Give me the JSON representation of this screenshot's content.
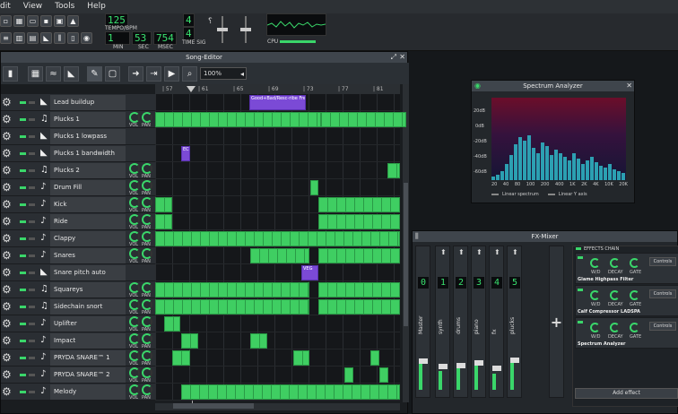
{
  "menu": {
    "items": [
      "dit",
      "View",
      "Tools",
      "Help"
    ]
  },
  "transport": {
    "min": "1",
    "sec": "53",
    "msec": "754",
    "min_label": "MIN",
    "sec_label": "SEC",
    "msec_label": "MSEC",
    "tempo": "125",
    "tempo_label": "TEMPO/BPM",
    "ts_top": "4",
    "ts_bottom": "4",
    "ts_label": "TIME SIG",
    "cpu_label": "CPU"
  },
  "song_editor": {
    "title": "Song-Editor",
    "zoom": "100%",
    "ruler": [
      "| 57",
      "| 61",
      "| 65",
      "| 69",
      "| 73",
      "| 77",
      "| 81"
    ],
    "tracks": [
      {
        "name": "Lead buildup",
        "type": "automation"
      },
      {
        "name": "Plucks 1",
        "type": "instrument"
      },
      {
        "name": "Plucks 1 lowpass",
        "type": "automation"
      },
      {
        "name": "Plucks 1 bandwidth",
        "type": "automation"
      },
      {
        "name": "Plucks 2",
        "type": "instrument"
      },
      {
        "name": "Drum Fill",
        "type": "sample"
      },
      {
        "name": "Kick",
        "type": "sample"
      },
      {
        "name": "Ride",
        "type": "sample"
      },
      {
        "name": "Clappy",
        "type": "sample"
      },
      {
        "name": "Snares",
        "type": "sample"
      },
      {
        "name": "Snare pitch auto",
        "type": "automation"
      },
      {
        "name": "Squareys",
        "type": "instrument"
      },
      {
        "name": "Sidechain snort",
        "type": "instrument"
      },
      {
        "name": "Uplifter",
        "type": "sample"
      },
      {
        "name": "Impact",
        "type": "sample"
      },
      {
        "name": "PRYDA SNARE™ 1",
        "type": "sample"
      },
      {
        "name": "PRYDA SNARE™ 2",
        "type": "sample"
      },
      {
        "name": "Melody",
        "type": "sample"
      }
    ],
    "vol_label": "VOL",
    "pan_label": "PAN",
    "clip_labels": {
      "lead": "Good+Bad/Resc-ribe Frequ",
      "plucks_bw": "EC",
      "snare_pitch": "VEG"
    }
  },
  "analyzer": {
    "title": "Spectrum Analyzer",
    "db": [
      "20dB",
      "0dB",
      "-20dB",
      "-40dB",
      "-60dB"
    ],
    "freq": [
      "20",
      "40",
      "80",
      "100",
      "200",
      "400",
      "1K",
      "2K",
      "4K",
      "10K",
      "20K"
    ],
    "linear_spectrum": "Linear spectrum",
    "linear_y": "Linear Y axis"
  },
  "mixer": {
    "title": "FX-Mixer",
    "effects_chain": "EFFECTS CHAIN",
    "add_effect": "Add effect",
    "channels": [
      {
        "num": "0",
        "name": "Master"
      },
      {
        "num": "1",
        "name": "synth"
      },
      {
        "num": "2",
        "name": "drums"
      },
      {
        "num": "3",
        "name": "piano"
      },
      {
        "num": "4",
        "name": "fx"
      },
      {
        "num": "5",
        "name": "plucks"
      }
    ],
    "fx": [
      {
        "name": "Glame Highpass Filter",
        "controls": "Controls"
      },
      {
        "name": "Calf Compressor LADSPA",
        "controls": "Controls"
      },
      {
        "name": "Spectrum Analyzer",
        "controls": "Controls"
      }
    ],
    "knobs": [
      "W/D",
      "DECAY",
      "GATE"
    ]
  },
  "colors": {
    "green": "#3fce62",
    "purple": "#7b4ad6"
  }
}
